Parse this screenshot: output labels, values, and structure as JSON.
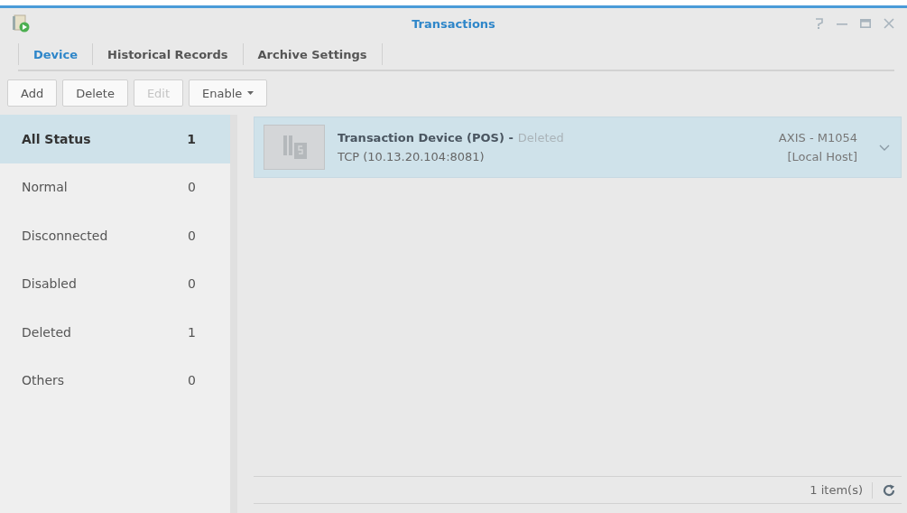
{
  "window": {
    "title": "Transactions"
  },
  "tabs": [
    {
      "label": "Device",
      "selected": true
    },
    {
      "label": "Historical Records",
      "selected": false
    },
    {
      "label": "Archive Settings",
      "selected": false
    }
  ],
  "toolbar": [
    {
      "label": "Add",
      "kind": "button",
      "disabled": false
    },
    {
      "label": "Delete",
      "kind": "button",
      "disabled": false
    },
    {
      "label": "Edit",
      "kind": "button",
      "disabled": true
    },
    {
      "label": "Enable",
      "kind": "dropdown",
      "disabled": false
    }
  ],
  "status_filters": [
    {
      "label": "All Status",
      "count": "1",
      "selected": true
    },
    {
      "label": "Normal",
      "count": "0",
      "selected": false
    },
    {
      "label": "Disconnected",
      "count": "0",
      "selected": false
    },
    {
      "label": "Disabled",
      "count": "0",
      "selected": false
    },
    {
      "label": "Deleted",
      "count": "1",
      "selected": false
    },
    {
      "label": "Others",
      "count": "0",
      "selected": false
    }
  ],
  "devices": [
    {
      "name": "Transaction Device (POS) -",
      "status": "Deleted",
      "connection": "TCP (10.13.20.104:8081)",
      "model": "AXIS - M1054",
      "host": "[Local Host]",
      "selected": true
    }
  ],
  "footer": {
    "count": "1 item(s)"
  }
}
